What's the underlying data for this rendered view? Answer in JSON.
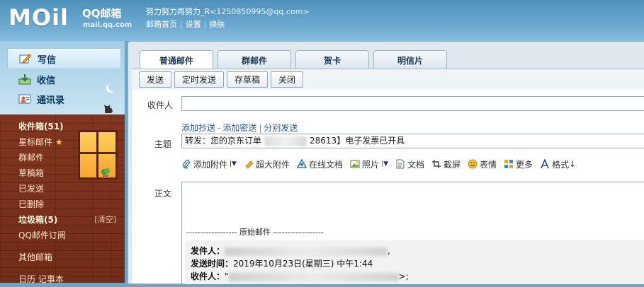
{
  "header": {
    "logo_text": "MOil",
    "brand": "QQ邮箱",
    "domain": "mail.qq.com",
    "user_nick": "努力努力再努力_R",
    "user_email": "<1250850995@qq.com>",
    "nav": [
      "邮箱首页",
      "设置",
      "换肤"
    ]
  },
  "sidebar": {
    "main_menu": [
      {
        "label": "写信",
        "icon": "pencil-icon"
      },
      {
        "label": "收信",
        "icon": "inbox-icon"
      },
      {
        "label": "通讯录",
        "icon": "contacts-icon"
      }
    ],
    "folders": [
      {
        "label": "收件箱(51)",
        "bold": true
      },
      {
        "label": "星标邮件",
        "star": "★"
      },
      {
        "label": "群邮件"
      },
      {
        "label": "草稿箱"
      },
      {
        "label": "已发送"
      },
      {
        "label": "已删除"
      },
      {
        "label": "垃圾箱(5)",
        "bold": true,
        "action": "[清空]"
      },
      {
        "label": "QQ邮件订阅"
      },
      {
        "label": "其他邮箱"
      },
      {
        "label": "日历 记事本"
      }
    ]
  },
  "compose": {
    "tabs": [
      "普通邮件",
      "群邮件",
      "贺卡",
      "明信片"
    ],
    "active_tab": "普通邮件",
    "toolbar": [
      "发送",
      "定时发送",
      "存草稿",
      "关闭"
    ],
    "to_label": "收件人",
    "to_value": "",
    "cc_links": [
      "添加抄送",
      "添加密送",
      "分别发送"
    ],
    "subject_label": "主题",
    "subject_prefix": "转发：您的京东订单",
    "subject_suffix": "28613】电子发票已开具",
    "attach_bar": [
      {
        "label": "添加附件",
        "icon": "paperclip-icon",
        "dropdown": true
      },
      {
        "label": "超大附件",
        "icon": "big-attachment-icon"
      },
      {
        "label": "在线文档",
        "icon": "online-doc-icon"
      },
      {
        "label": "照片",
        "icon": "photo-icon",
        "dropdown": true
      },
      {
        "label": "文档",
        "icon": "document-icon"
      },
      {
        "label": "截屏",
        "icon": "screenshot-icon"
      },
      {
        "label": "表情",
        "icon": "emoji-icon"
      },
      {
        "label": "更多",
        "icon": "more-icon"
      },
      {
        "label": "格式",
        "icon": "format-icon",
        "dropdown_arrow": "↓"
      }
    ],
    "body_label": "正文",
    "original_separator": "------------------ 原始邮件 ------------------",
    "quote": {
      "from_label": "发件人：",
      "from_suffix": ",",
      "date_label": "发送时间：",
      "date_value": "2019年10月23日(星期三) 中午1:44",
      "to_label": "收件人：",
      "to_value": "\"",
      "to_suffix": ">;"
    }
  },
  "colors": {
    "header_blue": "#4f90bb",
    "brick": "#8f3c23",
    "window_light": "#ffcd5a",
    "link": "#2a5a8a"
  }
}
